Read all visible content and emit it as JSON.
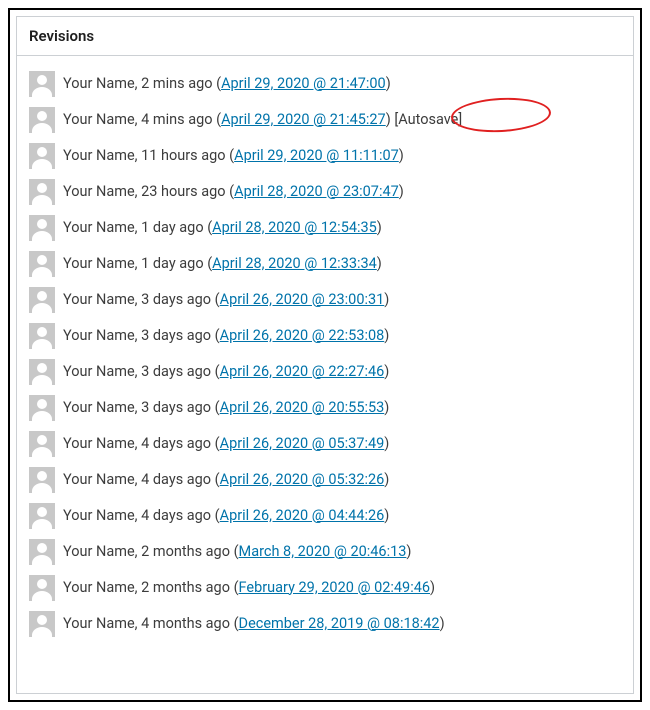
{
  "panel": {
    "title": "Revisions"
  },
  "revisions": [
    {
      "author": "Your Name",
      "relative": "2 mins ago",
      "timestamp": "April 29, 2020 @ 21:47:00",
      "autosave": false
    },
    {
      "author": "Your Name",
      "relative": "4 mins ago",
      "timestamp": "April 29, 2020 @ 21:45:27",
      "autosave": true
    },
    {
      "author": "Your Name",
      "relative": "11 hours ago",
      "timestamp": "April 29, 2020 @ 11:11:07",
      "autosave": false
    },
    {
      "author": "Your Name",
      "relative": "23 hours ago",
      "timestamp": "April 28, 2020 @ 23:07:47",
      "autosave": false
    },
    {
      "author": "Your Name",
      "relative": "1 day ago",
      "timestamp": "April 28, 2020 @ 12:54:35",
      "autosave": false
    },
    {
      "author": "Your Name",
      "relative": "1 day ago",
      "timestamp": "April 28, 2020 @ 12:33:34",
      "autosave": false
    },
    {
      "author": "Your Name",
      "relative": "3 days ago",
      "timestamp": "April 26, 2020 @ 23:00:31",
      "autosave": false
    },
    {
      "author": "Your Name",
      "relative": "3 days ago",
      "timestamp": "April 26, 2020 @ 22:53:08",
      "autosave": false
    },
    {
      "author": "Your Name",
      "relative": "3 days ago",
      "timestamp": "April 26, 2020 @ 22:27:46",
      "autosave": false
    },
    {
      "author": "Your Name",
      "relative": "3 days ago",
      "timestamp": "April 26, 2020 @ 20:55:53",
      "autosave": false
    },
    {
      "author": "Your Name",
      "relative": "4 days ago",
      "timestamp": "April 26, 2020 @ 05:37:49",
      "autosave": false
    },
    {
      "author": "Your Name",
      "relative": "4 days ago",
      "timestamp": "April 26, 2020 @ 05:32:26",
      "autosave": false
    },
    {
      "author": "Your Name",
      "relative": "4 days ago",
      "timestamp": "April 26, 2020 @ 04:44:26",
      "autosave": false
    },
    {
      "author": "Your Name",
      "relative": "2 months ago",
      "timestamp": "March 8, 2020 @ 20:46:13",
      "autosave": false
    },
    {
      "author": "Your Name",
      "relative": "2 months ago",
      "timestamp": "February 29, 2020 @ 02:49:46",
      "autosave": false
    },
    {
      "author": "Your Name",
      "relative": "4 months ago",
      "timestamp": "December 28, 2019 @ 08:18:42",
      "autosave": false
    }
  ],
  "labels": {
    "autosave": "[Autosave]"
  }
}
